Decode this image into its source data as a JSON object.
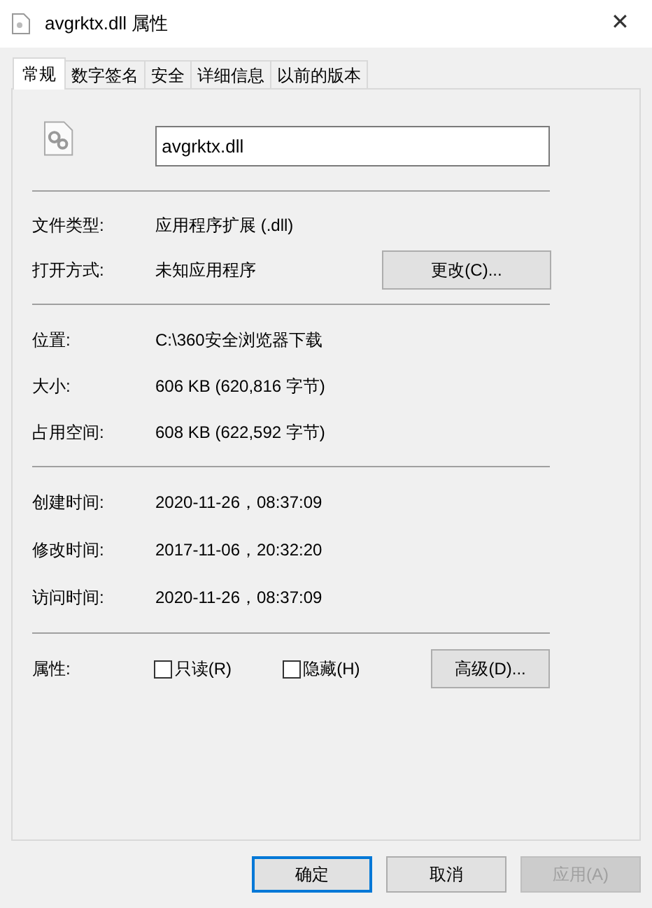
{
  "window": {
    "title": "avgrktx.dll 属性",
    "close": "✕"
  },
  "tabs": [
    {
      "label": "常规",
      "selected": true
    },
    {
      "label": "数字签名",
      "selected": false
    },
    {
      "label": "安全",
      "selected": false
    },
    {
      "label": "详细信息",
      "selected": false
    },
    {
      "label": "以前的版本",
      "selected": false
    }
  ],
  "name_field": {
    "value": "avgrktx.dll"
  },
  "sections": [
    [
      {
        "label": "文件类型:",
        "value": "应用程序扩展 (.dll)"
      },
      {
        "label": "打开方式:",
        "value": "未知应用程序",
        "button": "更改(C)..."
      }
    ],
    [
      {
        "label": "位置:",
        "value": "C:\\360安全浏览器下载"
      },
      {
        "label": "大小:",
        "value": "606 KB (620,816 字节)"
      },
      {
        "label": "占用空间:",
        "value": "608 KB (622,592 字节)"
      }
    ],
    [
      {
        "label": "创建时间:",
        "value": "2020-11-26，08:37:09"
      },
      {
        "label": "修改时间:",
        "value": "2017-11-06，20:32:20"
      },
      {
        "label": "访问时间:",
        "value": "2020-11-26，08:37:09"
      }
    ]
  ],
  "attributes": {
    "label": "属性:",
    "checkboxes": [
      {
        "label": "只读(R)",
        "checked": false
      },
      {
        "label": "隐藏(H)",
        "checked": false
      }
    ],
    "button": "高级(D)..."
  },
  "buttons": [
    {
      "label": "确定",
      "default": true,
      "disabled": false
    },
    {
      "label": "取消",
      "default": false,
      "disabled": false
    },
    {
      "label": "应用(A)",
      "default": false,
      "disabled": true
    }
  ]
}
